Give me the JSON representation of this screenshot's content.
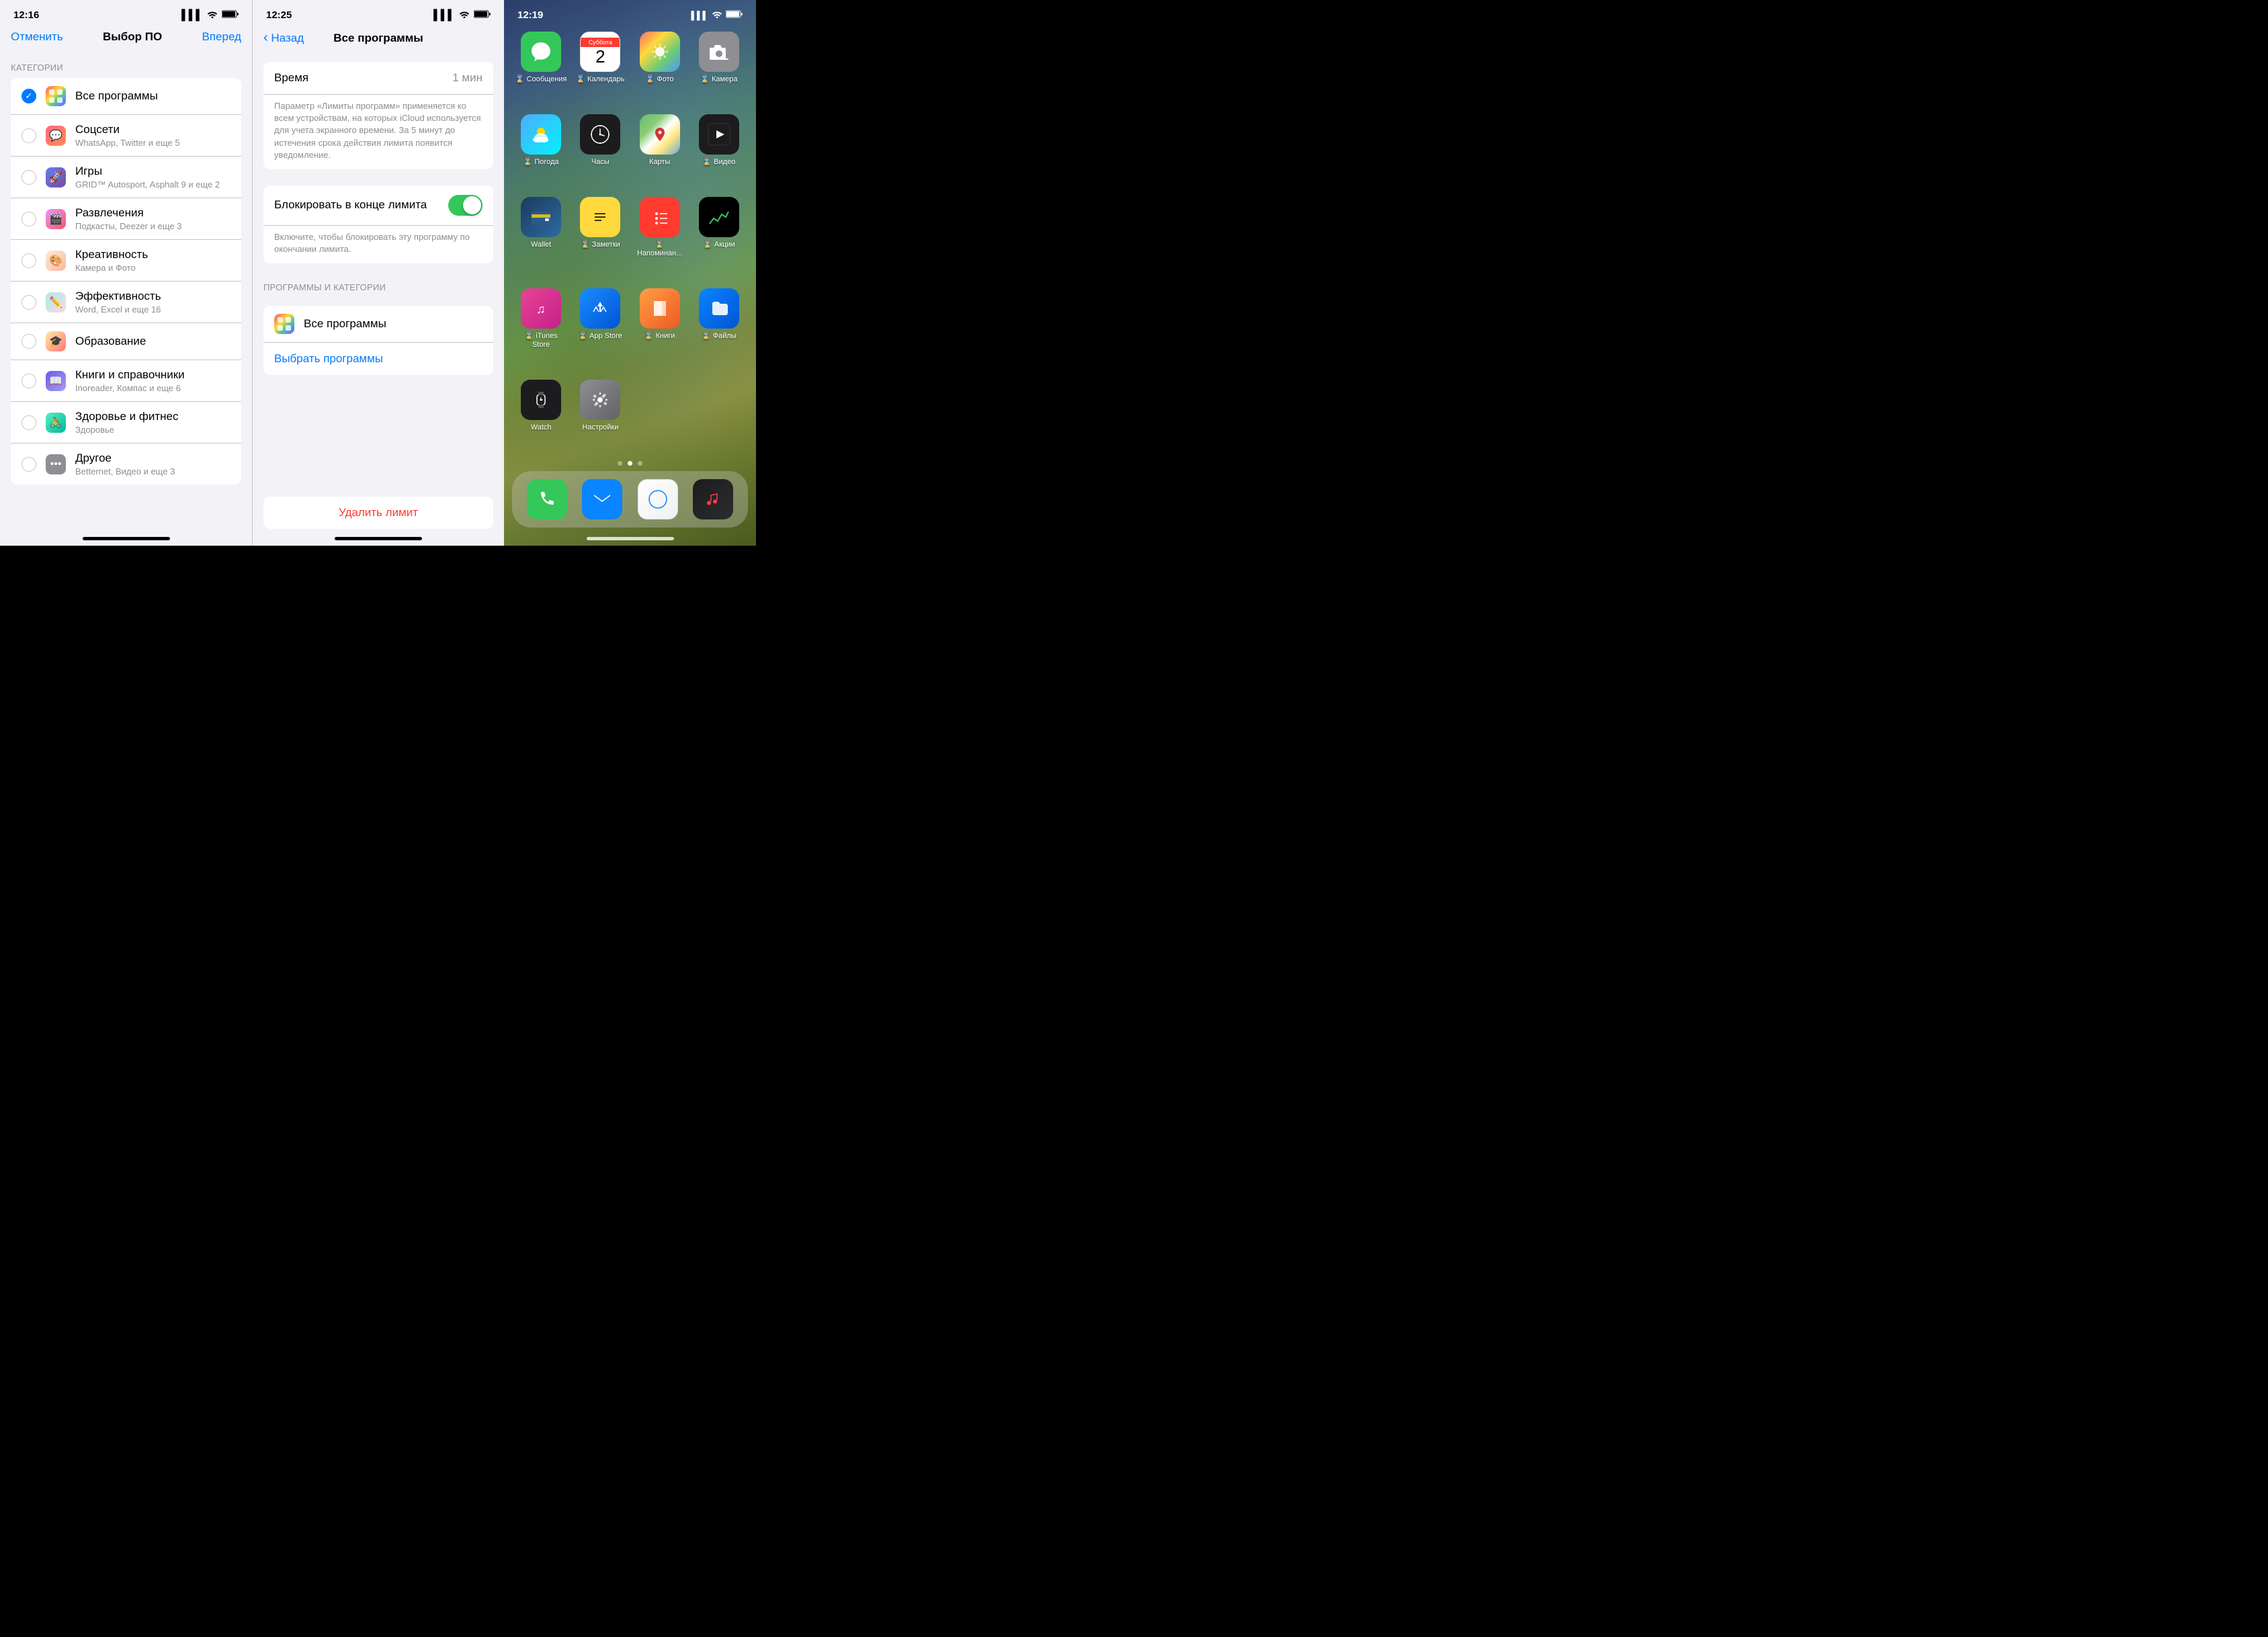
{
  "panel1": {
    "status_time": "12:16",
    "nav": {
      "cancel": "Отменить",
      "title": "Выбор ПО",
      "forward": "Вперед"
    },
    "section_header": "КАТЕГОРИИ",
    "items": [
      {
        "id": "all",
        "label": "Все программы",
        "subtitle": "",
        "checked": true,
        "icon": "all-apps"
      },
      {
        "id": "social",
        "label": "Соцсети",
        "subtitle": "WhatsApp, Twitter и еще 5",
        "checked": false,
        "icon": "social"
      },
      {
        "id": "games",
        "label": "Игры",
        "subtitle": "GRID™ Autosport, Asphalt 9 и еще 2",
        "checked": false,
        "icon": "games"
      },
      {
        "id": "entertainment",
        "label": "Развлечения",
        "subtitle": "Подкасты, Deezer и еще 3",
        "checked": false,
        "icon": "entertainment"
      },
      {
        "id": "creative",
        "label": "Креативность",
        "subtitle": "Камера и Фото",
        "checked": false,
        "icon": "creative"
      },
      {
        "id": "productivity",
        "label": "Эффективность",
        "subtitle": "Word, Excel и еще 16",
        "checked": false,
        "icon": "productivity"
      },
      {
        "id": "education",
        "label": "Образование",
        "subtitle": "",
        "checked": false,
        "icon": "education"
      },
      {
        "id": "books",
        "label": "Книги и справочники",
        "subtitle": "Inoreader, Компас и еще 6",
        "checked": false,
        "icon": "books"
      },
      {
        "id": "health",
        "label": "Здоровье и фитнес",
        "subtitle": "Здоровье",
        "checked": false,
        "icon": "health"
      },
      {
        "id": "other",
        "label": "Другое",
        "subtitle": "Betternet, Видео и еще 3",
        "checked": false,
        "icon": "other"
      }
    ]
  },
  "panel2": {
    "status_time": "12:25",
    "nav": {
      "back": "Назад",
      "title": "Все программы"
    },
    "time_row": {
      "label": "Время",
      "value": "1 мин"
    },
    "time_description": "Параметр «Лимиты программ» применяется ко всем устройствам, на которых iCloud используется для учета экранного времени. За 5 минут до истечения срока действия лимита появится уведомление.",
    "block_row": {
      "label": "Блокировать в конце лимита",
      "toggle_on": true
    },
    "block_description": "Включите, чтобы блокировать эту программу по окончании лимита.",
    "section_header": "ПРОГРАММЫ И КАТЕГОРИИ",
    "app_row": {
      "icon": "all-apps",
      "name": "Все программы"
    },
    "choose_btn": "Выбрать программы",
    "delete_btn": "Удалить лимит"
  },
  "panel3": {
    "status_time": "12:19",
    "apps": [
      {
        "id": "messages",
        "label": "Сообщения",
        "icon": "messages",
        "badge": "Сообщения"
      },
      {
        "id": "calendar",
        "label": "Календарь",
        "icon": "calendar",
        "badge": "Календарь",
        "day": "2",
        "weekday": "Суббота"
      },
      {
        "id": "photos",
        "label": "Фото",
        "icon": "photos",
        "badge": "Фото"
      },
      {
        "id": "camera",
        "label": "Камера",
        "icon": "camera",
        "badge": "Камера"
      },
      {
        "id": "weather",
        "label": "Погода",
        "icon": "weather",
        "badge": "Погода"
      },
      {
        "id": "clock",
        "label": "Часы",
        "icon": "clock",
        "badge": "Часы"
      },
      {
        "id": "maps",
        "label": "Карты",
        "icon": "maps",
        "badge": "Карты"
      },
      {
        "id": "video",
        "label": "Видео",
        "icon": "video",
        "badge": "Видео"
      },
      {
        "id": "wallet",
        "label": "Wallet",
        "icon": "wallet",
        "badge": "Wallet"
      },
      {
        "id": "notes",
        "label": "Заметки",
        "icon": "notes",
        "badge": "Заметки"
      },
      {
        "id": "reminders",
        "label": "Напоминан...",
        "icon": "reminders",
        "badge": "Напоминан..."
      },
      {
        "id": "stocks",
        "label": "Акции",
        "icon": "stocks",
        "badge": "Акции"
      },
      {
        "id": "itunes",
        "label": "iTunes Store",
        "icon": "itunes",
        "badge": "iTunes Store"
      },
      {
        "id": "appstore",
        "label": "App Store",
        "icon": "appstore",
        "badge": "App Store"
      },
      {
        "id": "books",
        "label": "Книги",
        "icon": "books",
        "badge": "Книги"
      },
      {
        "id": "files",
        "label": "Файлы",
        "icon": "files",
        "badge": "Файлы"
      },
      {
        "id": "watch",
        "label": "Watch",
        "icon": "watch",
        "badge": "Watch"
      },
      {
        "id": "settings",
        "label": "Настройки",
        "icon": "settings",
        "badge": "Настройки"
      }
    ],
    "dock": [
      {
        "id": "phone",
        "label": "Телефон",
        "icon": "phone"
      },
      {
        "id": "mail",
        "label": "Почта",
        "icon": "mail"
      },
      {
        "id": "safari",
        "label": "Safari",
        "icon": "safari"
      },
      {
        "id": "music",
        "label": "Музыка",
        "icon": "music"
      }
    ],
    "badges": {
      "messages_prefix": "⌛ ",
      "calendar_prefix": "⌛ ",
      "photos_prefix": "⌛ ",
      "camera_prefix": "⌛ "
    }
  },
  "icons": {
    "signal": "▌▌▌",
    "wifi": "WiFi",
    "battery": "🔋",
    "checkmark": "✓",
    "back_arrow": "‹"
  }
}
